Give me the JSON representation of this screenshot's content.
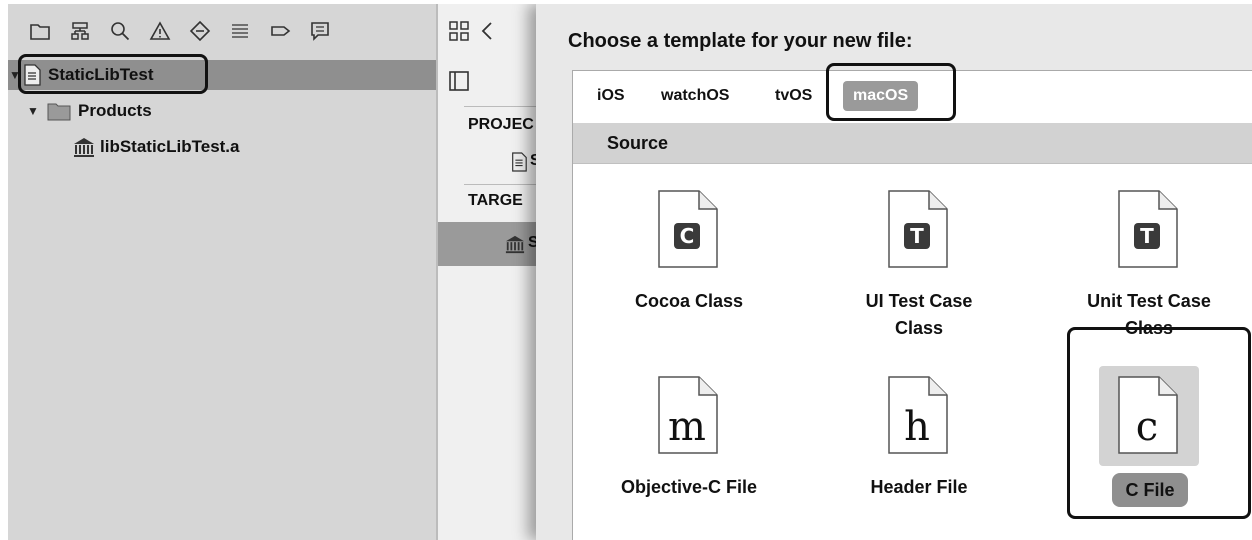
{
  "navigator": {
    "toolbar_icons": [
      "folder-icon",
      "hierarchy-icon",
      "search-icon",
      "warning-icon",
      "test-diamond-icon",
      "list-icon",
      "breakpoint-tag-icon",
      "comment-icon"
    ],
    "tree": {
      "root": {
        "label": "StaticLibTest",
        "icon": "project-file-icon"
      },
      "products": {
        "label": "Products",
        "icon": "folder-icon",
        "expanded": true
      },
      "product_item": {
        "label": "libStaticLibTest.a",
        "icon": "library-icon"
      }
    }
  },
  "editor": {
    "toolbar_icons": [
      "grid-icon",
      "chevron-left-icon"
    ],
    "sidebar_toggle_icon": "sidebar-icon",
    "sections": [
      {
        "label": "PROJEC",
        "item_icon": "project-file-icon",
        "item_label": "S"
      },
      {
        "label": "TARGE",
        "item_icon": "library-icon",
        "item_label": "S"
      }
    ]
  },
  "template_sheet": {
    "title": "Choose a template for your new file:",
    "tabs": [
      "iOS",
      "watchOS",
      "tvOS",
      "macOS"
    ],
    "selected_tab": "macOS",
    "section_title": "Source",
    "templates": [
      {
        "label": "Cocoa Class",
        "glyph": "C",
        "glyph_style": "badge"
      },
      {
        "label": "UI Test Case\nClass",
        "glyph": "T",
        "glyph_style": "badge"
      },
      {
        "label": "Unit Test Case\nClass",
        "glyph": "T",
        "glyph_style": "badge"
      },
      {
        "label": "Objective-C File",
        "glyph": "m",
        "glyph_style": "serif"
      },
      {
        "label": "Header File",
        "glyph": "h",
        "glyph_style": "serif"
      },
      {
        "label": "C File",
        "glyph": "c",
        "glyph_style": "serif",
        "selected": true
      }
    ]
  },
  "colors": {
    "navigator_bg": "#d6d6d6",
    "selected_row": "#8f8f8f",
    "tab_selected": "#9a9a9a",
    "section_bar": "#d2d2d2",
    "annotation_box": "#111111"
  }
}
